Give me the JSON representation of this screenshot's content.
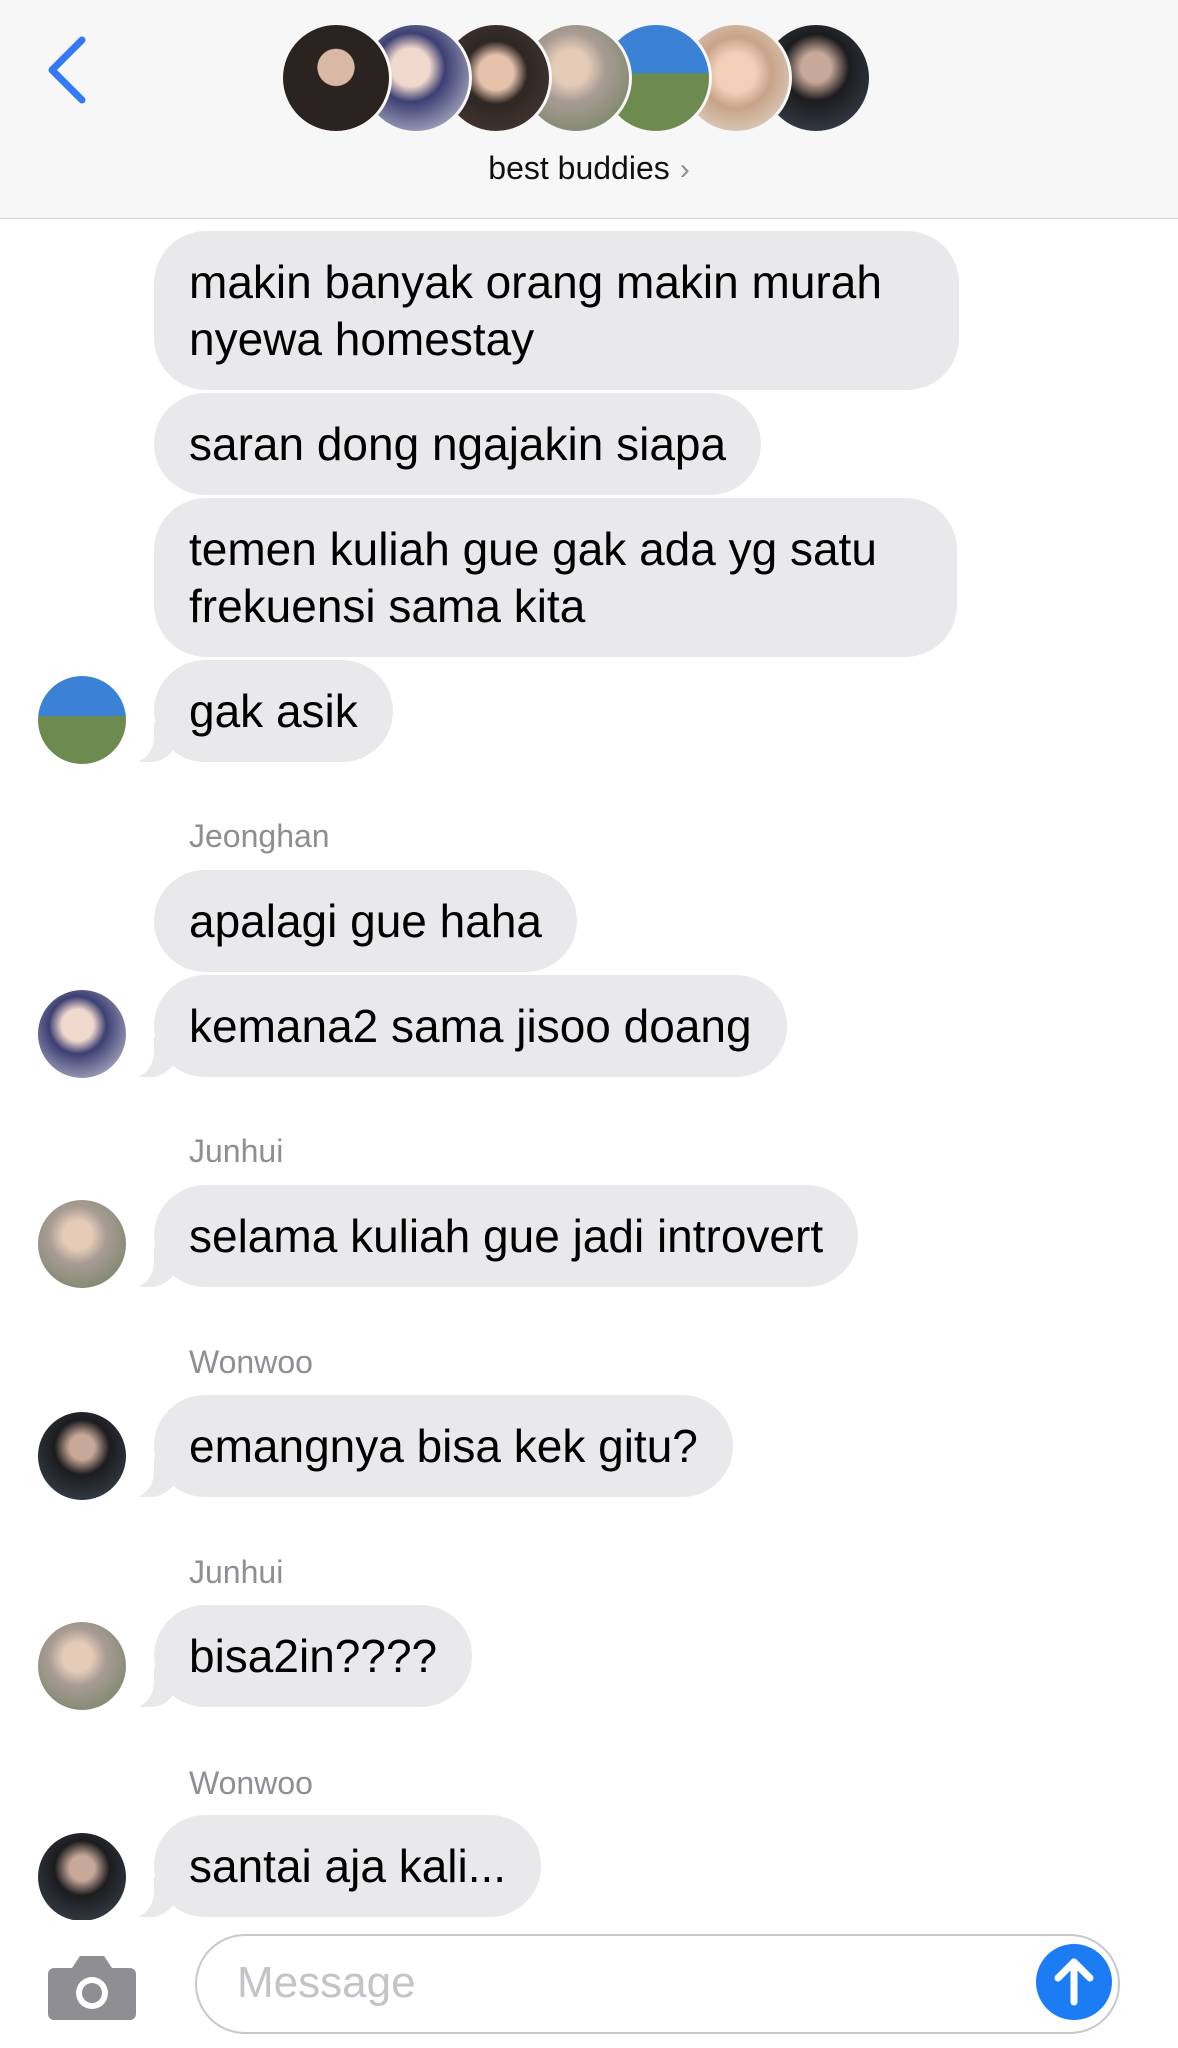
{
  "header": {
    "group_name": "best buddies",
    "chevron": "›",
    "back_icon": "chevron-left-icon",
    "accent_color": "#3478f6"
  },
  "messages": [
    {
      "text": "makin banyak orang makin murah nyewa homestay"
    },
    {
      "text": "saran dong ngajakin siapa"
    },
    {
      "text": "temen kuliah gue gak ada yg satu frekuensi sama kita"
    },
    {
      "text": "gak asik"
    },
    {
      "sender": "Jeonghan",
      "text": "apalagi gue haha"
    },
    {
      "text": "kemana2 sama jisoo doang"
    },
    {
      "sender": "Junhui",
      "text": "selama kuliah gue jadi introvert"
    },
    {
      "sender": "Wonwoo",
      "text": "emangnya bisa kek gitu?"
    },
    {
      "sender": "Junhui",
      "text": "bisa2in????"
    },
    {
      "sender": "Wonwoo",
      "text": "santai aja kali..."
    }
  ],
  "composer": {
    "placeholder": "Message",
    "camera_icon": "camera-icon",
    "send_icon": "arrow-up-icon",
    "send_color": "#1b7cf4"
  },
  "bubble_color": "#e9e9eb"
}
